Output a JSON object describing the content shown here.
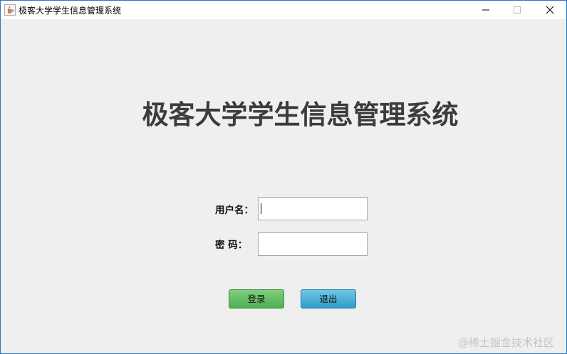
{
  "window": {
    "title": "极客大学学生信息管理系统",
    "icon": "java-cup-icon",
    "controls": [
      "minimize-icon",
      "maximize-icon",
      "close-icon"
    ]
  },
  "main": {
    "heading": "极客大学学生信息管理系统"
  },
  "form": {
    "username_label": "用户名：",
    "username_value": "",
    "password_label": "密 码：",
    "password_value": ""
  },
  "buttons": {
    "login_label": "登录",
    "exit_label": "退出"
  },
  "watermark": "@稀土掘金技术社区",
  "colors": {
    "login_button": "#5cb85c",
    "exit_button": "#3aa8d6",
    "window_border": "#2b78c5",
    "background": "#efefef"
  }
}
